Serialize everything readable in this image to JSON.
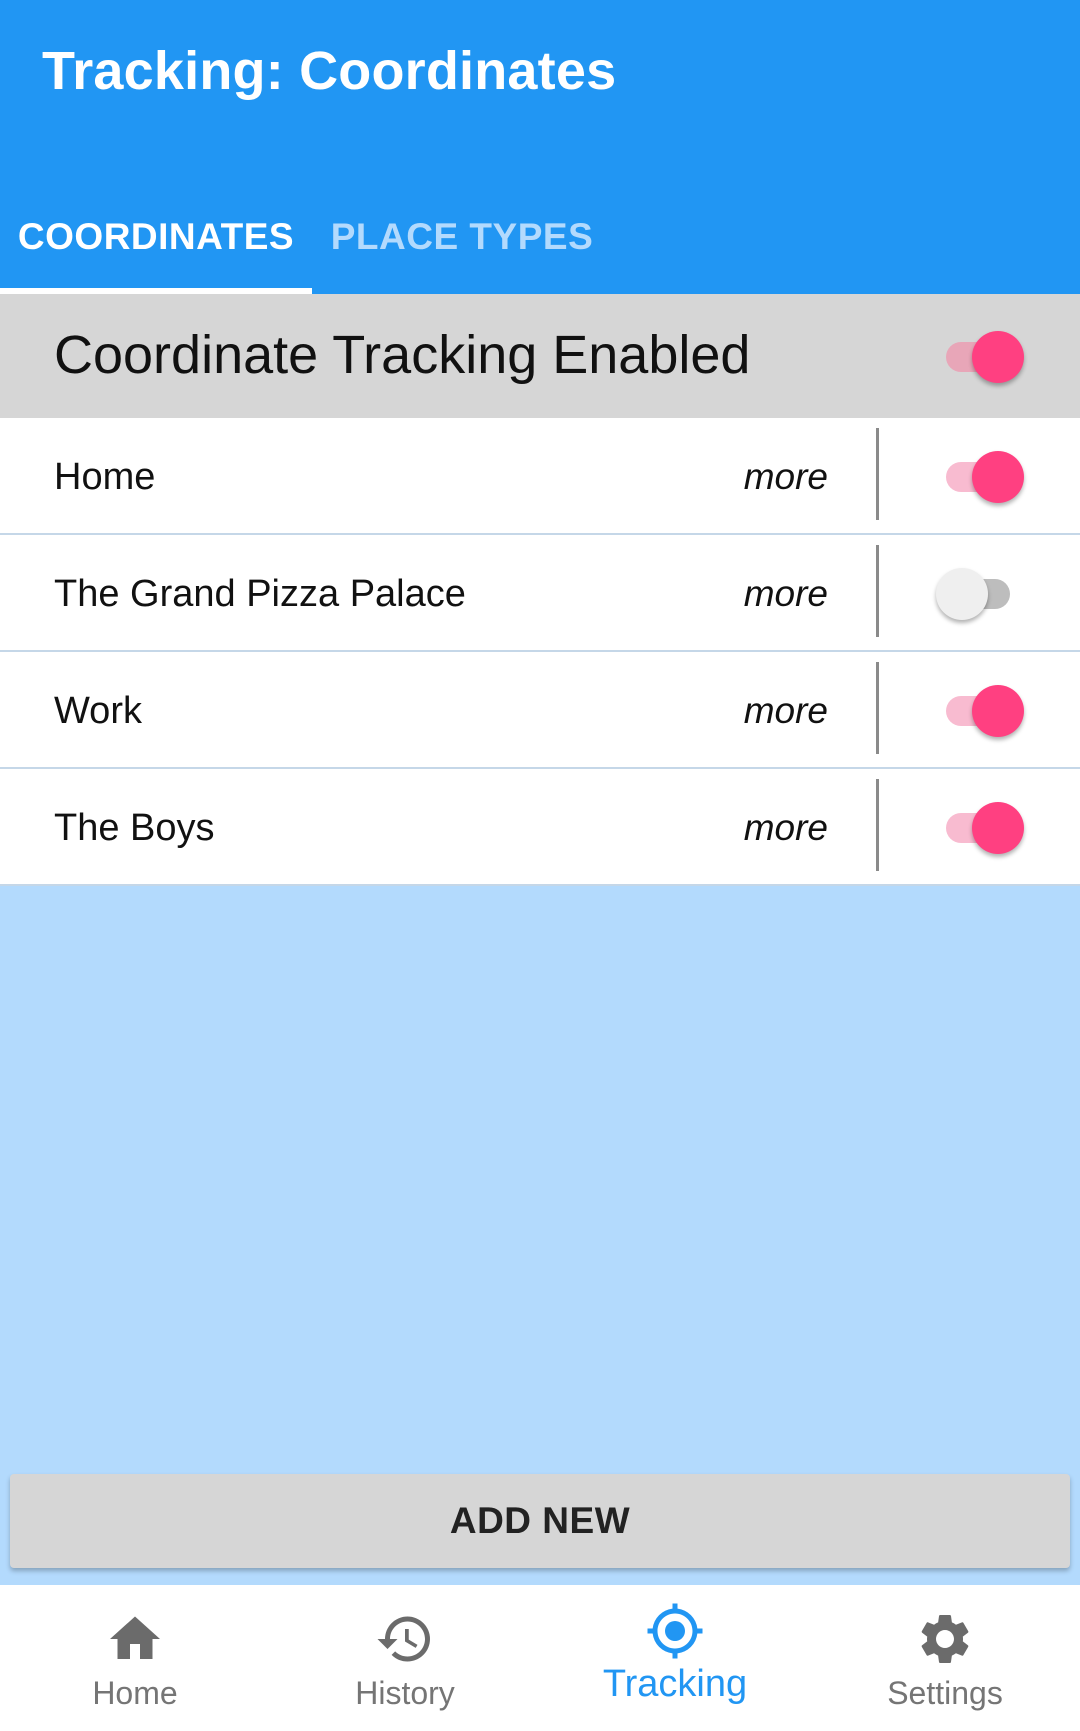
{
  "app_bar": {
    "title": "Tracking: Coordinates"
  },
  "tabs": [
    {
      "label": "COORDINATES",
      "active": true
    },
    {
      "label": "PLACE TYPES",
      "active": false
    }
  ],
  "master_toggle": {
    "label": "Coordinate Tracking Enabled",
    "enabled": true
  },
  "places": [
    {
      "name": "Home",
      "more_label": "more",
      "enabled": true
    },
    {
      "name": "The Grand Pizza Palace",
      "more_label": "more",
      "enabled": false
    },
    {
      "name": "Work",
      "more_label": "more",
      "enabled": true
    },
    {
      "name": "The Boys",
      "more_label": "more",
      "enabled": true
    }
  ],
  "add_button": {
    "label": "ADD NEW"
  },
  "bottom_nav": [
    {
      "label": "Home",
      "icon": "home-icon",
      "active": false
    },
    {
      "label": "History",
      "icon": "history-icon",
      "active": false
    },
    {
      "label": "Tracking",
      "icon": "gps-target-icon",
      "active": true
    },
    {
      "label": "Settings",
      "icon": "gear-icon",
      "active": false
    }
  ],
  "colors": {
    "primary": "#2196f3",
    "accent": "#ff4081",
    "background": "#b3dafd",
    "header_row": "#d6d6d6"
  }
}
